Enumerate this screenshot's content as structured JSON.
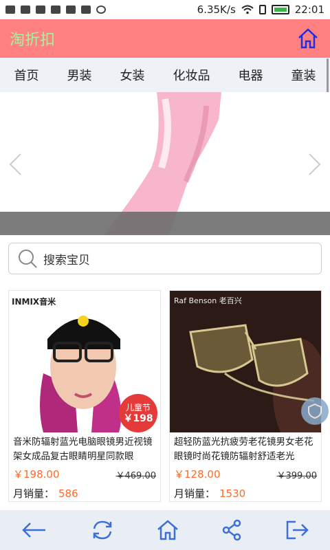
{
  "status": {
    "speed": "6.35K/s",
    "time": "22:01"
  },
  "header": {
    "title": "淘折扣"
  },
  "categories": [
    "首页",
    "男装",
    "女装",
    "化妆品",
    "电器",
    "童装"
  ],
  "search": {
    "placeholder": "搜索宝贝"
  },
  "products": [
    {
      "title": "音米防辐射蓝光电脑眼镜男近视镜架女成品复古眼睛明星同款眼",
      "price": "￥198.00",
      "old_price": "￥469.00",
      "sales_label": "月销量：",
      "sales": "586",
      "brand": "INMIX音米",
      "badge_line1": "儿童节",
      "badge_line2": "￥198"
    },
    {
      "title": "超轻防蓝光抗疲劳老花镜男女老花眼镜时尚花镜防辐射舒适老光",
      "price": "￥128.00",
      "old_price": "￥399.00",
      "sales_label": "月销量：",
      "sales": "1530",
      "brand": "Raf Benson 老百兴"
    }
  ],
  "colors": {
    "header_bg": "#ff8080",
    "title": "#a8f0a0",
    "accent": "#ff6a2a",
    "home_icon": "#1a2ee6"
  }
}
